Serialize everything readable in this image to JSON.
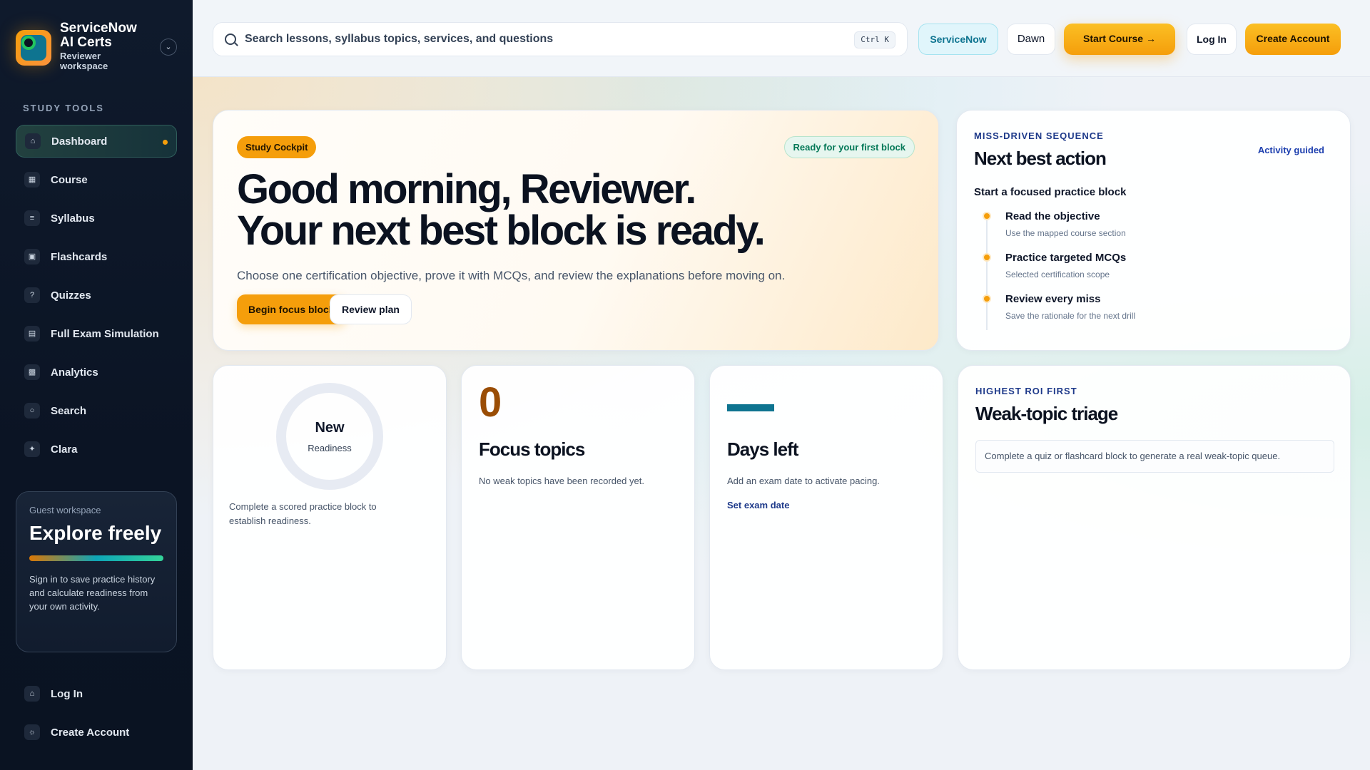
{
  "brand": {
    "name": "ServiceNow AI Certs",
    "subtitle": "Reviewer workspace"
  },
  "sidebar": {
    "section_label": "STUDY TOOLS",
    "items": [
      {
        "label": "Dashboard",
        "icon": "home-icon",
        "active": true
      },
      {
        "label": "Course",
        "icon": "book-icon"
      },
      {
        "label": "Syllabus",
        "icon": "list-icon"
      },
      {
        "label": "Flashcards",
        "icon": "cards-icon"
      },
      {
        "label": "Quizzes",
        "icon": "question-icon"
      },
      {
        "label": "Full Exam Simulation",
        "icon": "document-icon"
      },
      {
        "label": "Analytics",
        "icon": "bar-chart-icon"
      },
      {
        "label": "Search",
        "icon": "search-icon"
      },
      {
        "label": "Clara",
        "icon": "sparkle-icon"
      }
    ],
    "guest": {
      "title": "Guest workspace",
      "heading": "Explore freely",
      "text": "Sign in to save practice history and calculate readiness from your own activity."
    },
    "bottom": [
      {
        "label": "Log In",
        "icon": "login-icon"
      },
      {
        "label": "Create Account",
        "icon": "user-plus-icon"
      }
    ]
  },
  "topbar": {
    "search_placeholder": "Search lessons, syllabus topics, services, and questions",
    "shortcut": "Ctrl K",
    "platform_chip": "ServiceNow",
    "theme_chip": "Dawn",
    "start_course": "Start Course",
    "start_arrow": "→",
    "login": "Log In",
    "create_account": "Create Account"
  },
  "hero": {
    "badge": "Study Cockpit",
    "status": "Ready for your first block",
    "title_line1": "Good morning, Reviewer.",
    "title_line2": "Your next best block is ready.",
    "subtitle": "Choose one certification objective, prove it with MCQs, and review the explanations before moving on.",
    "primary_btn": "Begin focus block",
    "secondary_btn": "Review plan"
  },
  "next_best_action": {
    "eyebrow": "MISS-DRIVEN SEQUENCE",
    "title": "Next best action",
    "tag": "Activity guided",
    "lead": "Start a focused practice block",
    "steps": [
      {
        "title": "Read the objective",
        "sub": "Use the mapped course section"
      },
      {
        "title": "Practice targeted MCQs",
        "sub": "Selected certification scope"
      },
      {
        "title": "Review every miss",
        "sub": "Save the rationale for the next drill"
      }
    ]
  },
  "readiness": {
    "value": "New",
    "label": "Readiness",
    "note": "Complete a scored practice block to establish readiness."
  },
  "focus": {
    "count": "0",
    "title": "Focus topics",
    "desc": "No weak topics have been recorded yet."
  },
  "days": {
    "title": "Days left",
    "desc": "Add an exam date to activate pacing.",
    "link": "Set exam date"
  },
  "triage": {
    "eyebrow": "HIGHEST ROI FIRST",
    "title": "Weak-topic triage",
    "empty": "Complete a quiz or flashcard block to generate a real weak-topic queue."
  },
  "colors": {
    "accent": "#f59e0b",
    "sidebar_bg": "#0f1a2c",
    "teal": "#0e7490",
    "success": "#047857"
  }
}
